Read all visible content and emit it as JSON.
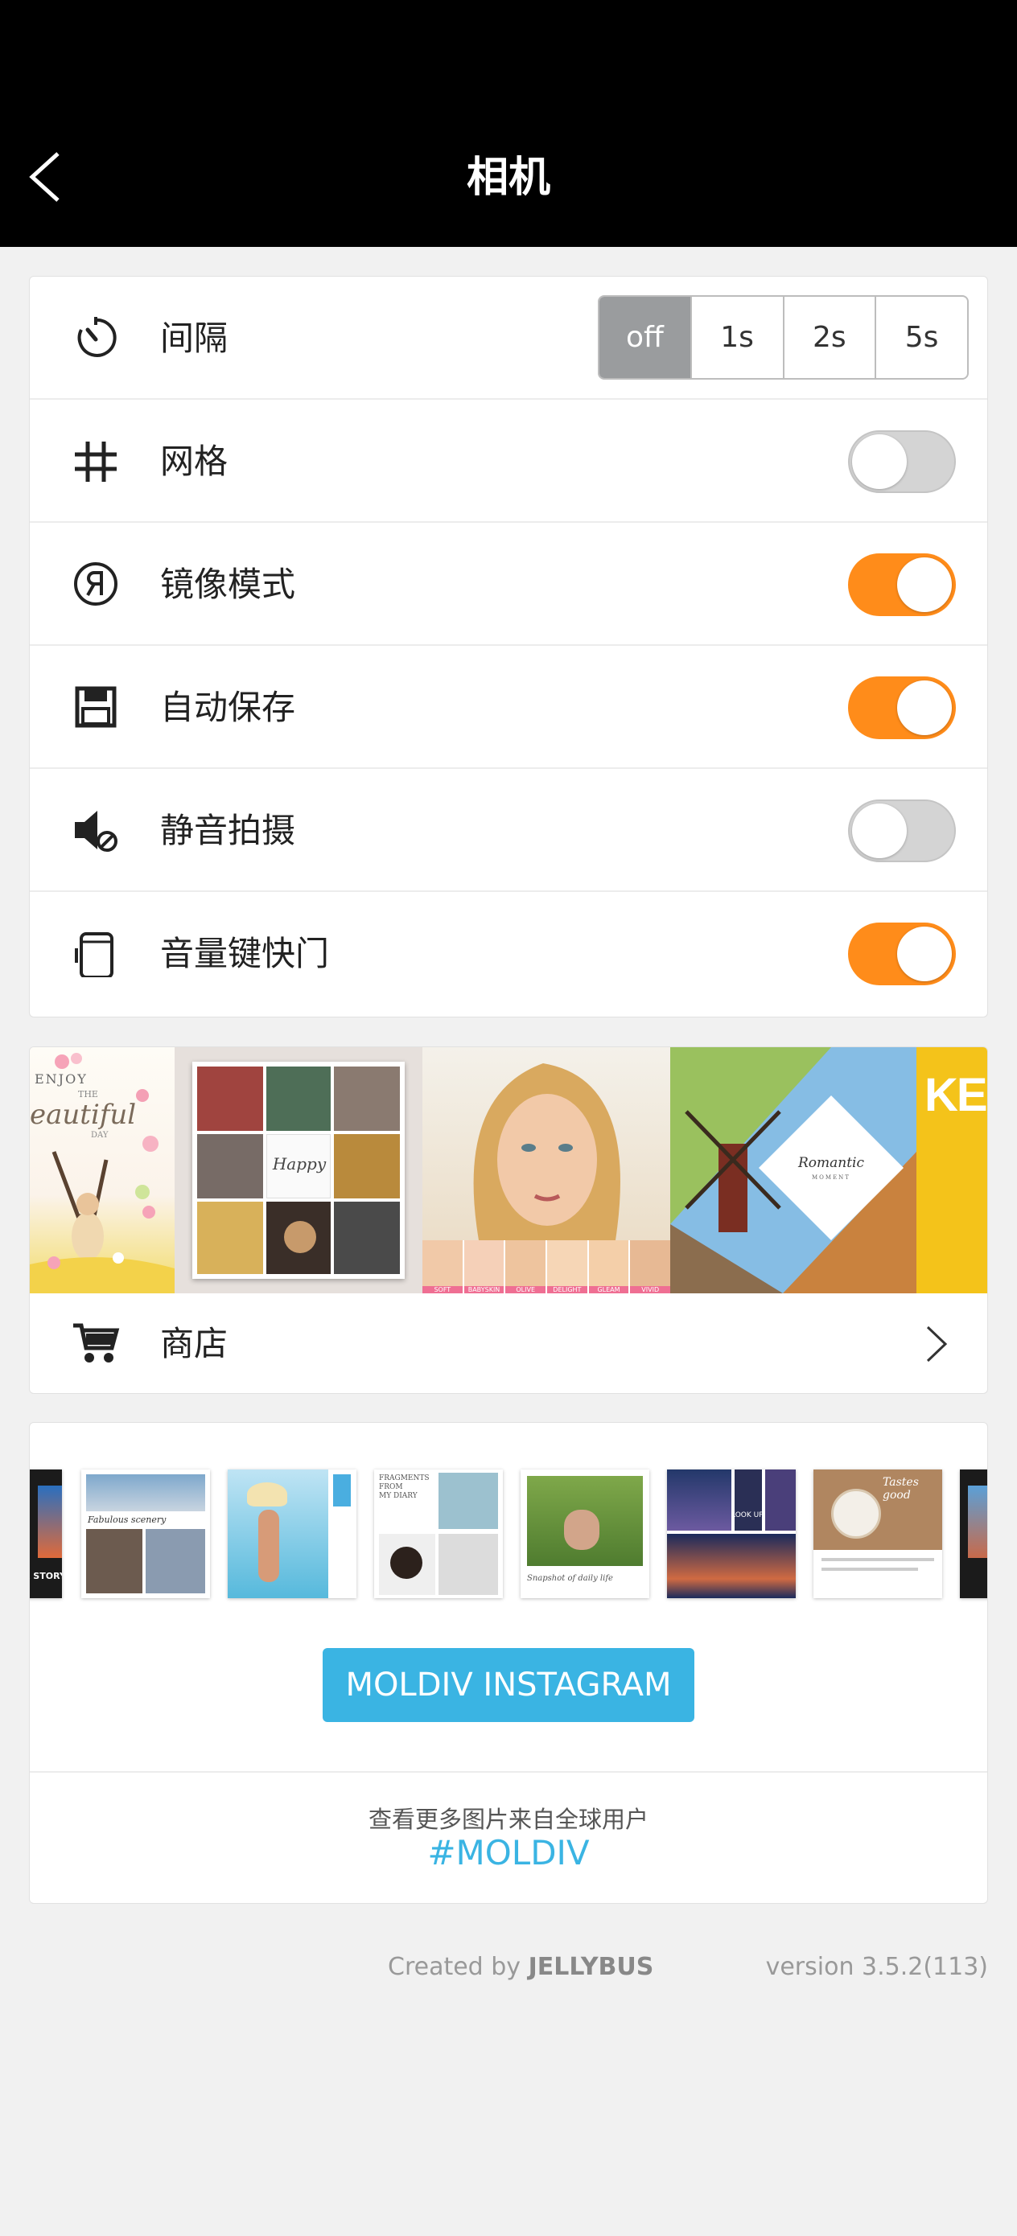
{
  "header": {
    "title": "相机"
  },
  "settings": {
    "interval": {
      "label": "间隔",
      "options": [
        "off",
        "1s",
        "2s",
        "5s"
      ],
      "selected": "off"
    },
    "grid": {
      "label": "网格",
      "on": false
    },
    "mirror": {
      "label": "镜像模式",
      "on": true
    },
    "autosave": {
      "label": "自动保存",
      "on": true
    },
    "silent": {
      "label": "静音拍摄",
      "on": false
    },
    "volume_shutter": {
      "label": "音量键快门",
      "on": true
    }
  },
  "store": {
    "label": "商店",
    "banner": {
      "tile1": {
        "line1": "ENJOY",
        "line2": "THE",
        "line3": "eautiful",
        "line4": "DAY"
      },
      "tile2": {
        "script": "Happy"
      },
      "tile3": {
        "filters": [
          "SOFT",
          "BABYSKIN",
          "OLIVE",
          "DELIGHT",
          "GLEAM",
          "VIVID"
        ]
      },
      "tile4": {
        "script": "Romantic",
        "sub": "MOMENT"
      },
      "tile5": {
        "text": "KEE"
      }
    }
  },
  "instagram": {
    "thumb_texts": {
      "t1": "R STORY",
      "t2": "Fabulous scenery",
      "t4a": "FRAGMENTS",
      "t4b": "FROM",
      "t4c": "MY DIARY",
      "t5": "Snapshot of daily life",
      "t6": "LOOK UP",
      "t7": "Tastes good"
    },
    "button_label": "MOLDIV INSTAGRAM",
    "note": "查看更多图片来自全球用户",
    "hashtag": "#MOLDIV"
  },
  "footer": {
    "created_prefix": "Created by ",
    "created_brand": "JELLYBUS",
    "version": "version 3.5.2(113)"
  },
  "colors": {
    "accent_orange": "#ff8c1a",
    "accent_blue": "#3ab4e3",
    "header_bg": "#000000"
  }
}
